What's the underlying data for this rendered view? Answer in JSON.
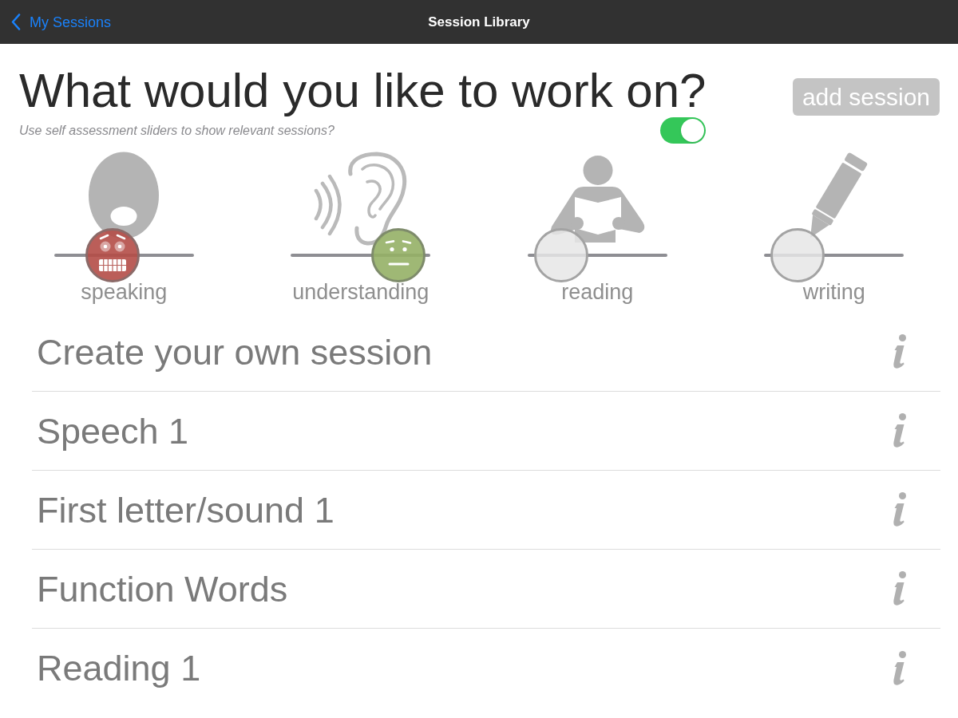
{
  "nav_bar": {
    "back_label": "My Sessions",
    "title": "Session Library"
  },
  "header": {
    "title": "What would you like to work on?",
    "add_session_button": {
      "label": "add session",
      "disabled": true
    },
    "slider_filter": {
      "label": "Use self assessment sliders to show relevant sessions?",
      "on": true
    }
  },
  "skills": [
    {
      "kind": "speaking",
      "label": "speaking",
      "level": 0.42,
      "thumb": {
        "kind": "worried"
      }
    },
    {
      "kind": "understanding",
      "label": "understanding",
      "level": 0.77,
      "thumb": {
        "kind": "neutral"
      }
    },
    {
      "kind": "reading",
      "label": "reading",
      "level": 0.24,
      "thumb": {
        "kind": "empty"
      }
    },
    {
      "kind": "writing",
      "label": "writing",
      "level": 0.24,
      "thumb": {
        "kind": "empty"
      }
    }
  ],
  "sessions": [
    {
      "title": "Create your own session"
    },
    {
      "title": "Speech 1"
    },
    {
      "title": "First letter/sound 1"
    },
    {
      "title": "Function Words"
    },
    {
      "title": "Reading 1"
    }
  ]
}
